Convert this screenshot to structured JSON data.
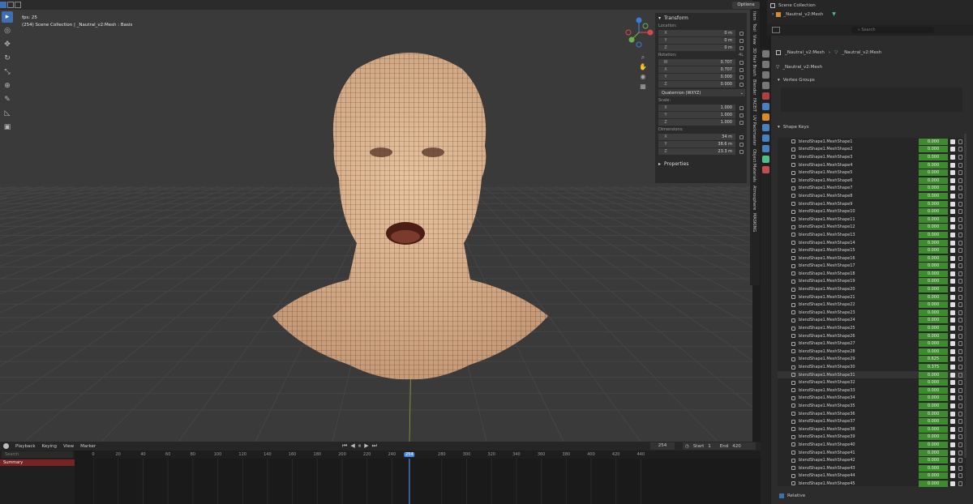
{
  "viewport": {
    "fps": "fps: 25",
    "context": "(254) Scene Collection | _Nautral_v2:Mesh : Basis",
    "options_label": "Options"
  },
  "transform": {
    "header": "Transform",
    "location_label": "Location:",
    "location": [
      {
        "axis": "X",
        "value": "0 m"
      },
      {
        "axis": "Y",
        "value": "0 m"
      },
      {
        "axis": "Z",
        "value": "0 m"
      }
    ],
    "rotation_label": "Rotation:",
    "rotation_mode_short": "4L",
    "rotation": [
      {
        "axis": "W",
        "value": "0.707"
      },
      {
        "axis": "X",
        "value": "0.707"
      },
      {
        "axis": "Y",
        "value": "0.000"
      },
      {
        "axis": "Z",
        "value": "0.000"
      }
    ],
    "rotation_mode": "Quaternion (WXYZ)",
    "scale_label": "Scale:",
    "scale": [
      {
        "axis": "X",
        "value": "1.000"
      },
      {
        "axis": "Y",
        "value": "1.000"
      },
      {
        "axis": "Z",
        "value": "1.000"
      }
    ],
    "dimensions_label": "Dimensions:",
    "dimensions": [
      {
        "axis": "X",
        "value": "34 m"
      },
      {
        "axis": "Y",
        "value": "38.6 m"
      },
      {
        "axis": "Z",
        "value": "23.3 m"
      }
    ],
    "properties_label": "Properties"
  },
  "sidetabs": [
    "Item",
    "Tool",
    "View",
    "3D Hair Brush",
    "Blender",
    "FACEIT",
    "UV Packmaster",
    "Object Materials",
    "Atmosphere",
    "MASKING"
  ],
  "outliner": {
    "collection": "Scene Collection",
    "object": "_Nautral_v2:Mesh"
  },
  "properties": {
    "search_placeholder": "Search",
    "breadcrumb_object": "_Nautral_v2:Mesh",
    "breadcrumb_mesh": "_Nautral_v2:Mesh",
    "mesh_name": "_Nautral_v2:Mesh",
    "vertex_groups_label": "Vertex Groups",
    "shape_keys_label": "Shape Keys",
    "relative_label": "Relative"
  },
  "shape_keys": [
    {
      "name": "blendShape1.MeshShape1",
      "value": "0.000"
    },
    {
      "name": "blendShape1.MeshShape2",
      "value": "0.000"
    },
    {
      "name": "blendShape1.MeshShape3",
      "value": "0.000"
    },
    {
      "name": "blendShape1.MeshShape4",
      "value": "0.000"
    },
    {
      "name": "blendShape1.MeshShape5",
      "value": "0.000"
    },
    {
      "name": "blendShape1.MeshShape6",
      "value": "0.000"
    },
    {
      "name": "blendShape1.MeshShape7",
      "value": "0.000"
    },
    {
      "name": "blendShape1.MeshShape8",
      "value": "0.000"
    },
    {
      "name": "blendShape1.MeshShape9",
      "value": "0.000"
    },
    {
      "name": "blendShape1.MeshShape10",
      "value": "0.000"
    },
    {
      "name": "blendShape1.MeshShape11",
      "value": "0.000"
    },
    {
      "name": "blendShape1.MeshShape12",
      "value": "0.000"
    },
    {
      "name": "blendShape1.MeshShape13",
      "value": "0.000"
    },
    {
      "name": "blendShape1.MeshShape14",
      "value": "0.000"
    },
    {
      "name": "blendShape1.MeshShape15",
      "value": "0.000"
    },
    {
      "name": "blendShape1.MeshShape16",
      "value": "0.000"
    },
    {
      "name": "blendShape1.MeshShape17",
      "value": "0.000"
    },
    {
      "name": "blendShape1.MeshShape18",
      "value": "0.000"
    },
    {
      "name": "blendShape1.MeshShape19",
      "value": "0.000"
    },
    {
      "name": "blendShape1.MeshShape20",
      "value": "0.000"
    },
    {
      "name": "blendShape1.MeshShape21",
      "value": "0.000"
    },
    {
      "name": "blendShape1.MeshShape22",
      "value": "0.000"
    },
    {
      "name": "blendShape1.MeshShape23",
      "value": "0.000"
    },
    {
      "name": "blendShape1.MeshShape24",
      "value": "0.000"
    },
    {
      "name": "blendShape1.MeshShape25",
      "value": "0.000"
    },
    {
      "name": "blendShape1.MeshShape26",
      "value": "0.000"
    },
    {
      "name": "blendShape1.MeshShape27",
      "value": "0.000"
    },
    {
      "name": "blendShape1.MeshShape28",
      "value": "0.000"
    },
    {
      "name": "blendShape1.MeshShape29",
      "value": "0.625"
    },
    {
      "name": "blendShape1.MeshShape30",
      "value": "0.375"
    },
    {
      "name": "blendShape1.MeshShape31",
      "value": "0.000"
    },
    {
      "name": "blendShape1.MeshShape32",
      "value": "0.000"
    },
    {
      "name": "blendShape1.MeshShape33",
      "value": "0.000"
    },
    {
      "name": "blendShape1.MeshShape34",
      "value": "0.000"
    },
    {
      "name": "blendShape1.MeshShape35",
      "value": "0.000"
    },
    {
      "name": "blendShape1.MeshShape36",
      "value": "0.000"
    },
    {
      "name": "blendShape1.MeshShape37",
      "value": "0.000"
    },
    {
      "name": "blendShape1.MeshShape38",
      "value": "0.000"
    },
    {
      "name": "blendShape1.MeshShape39",
      "value": "0.000"
    },
    {
      "name": "blendShape1.MeshShape40",
      "value": "0.000"
    },
    {
      "name": "blendShape1.MeshShape41",
      "value": "0.000"
    },
    {
      "name": "blendShape1.MeshShape42",
      "value": "0.000"
    },
    {
      "name": "blendShape1.MeshShape43",
      "value": "0.000"
    },
    {
      "name": "blendShape1.MeshShape44",
      "value": "0.000"
    },
    {
      "name": "blendShape1.MeshShape45",
      "value": "0.000"
    }
  ],
  "timeline": {
    "menus": [
      "Playback",
      "Keying",
      "View",
      "Marker"
    ],
    "search_placeholder": "Search",
    "summary_label": "Summary",
    "current_frame": "254",
    "start_label": "Start",
    "start_value": "1",
    "end_label": "End",
    "end_value": "420",
    "ruler_ticks": [
      "0",
      "20",
      "40",
      "60",
      "80",
      "100",
      "120",
      "140",
      "160",
      "180",
      "200",
      "220",
      "240",
      "254",
      "280",
      "300",
      "320",
      "340",
      "360",
      "380",
      "400",
      "420",
      "440"
    ]
  },
  "colors": {
    "accent_blue": "#3f6fb0",
    "shape_key_green": "#3e8a2f",
    "frame_marker": "#4a8be0",
    "summary_red": "#7a2323"
  }
}
